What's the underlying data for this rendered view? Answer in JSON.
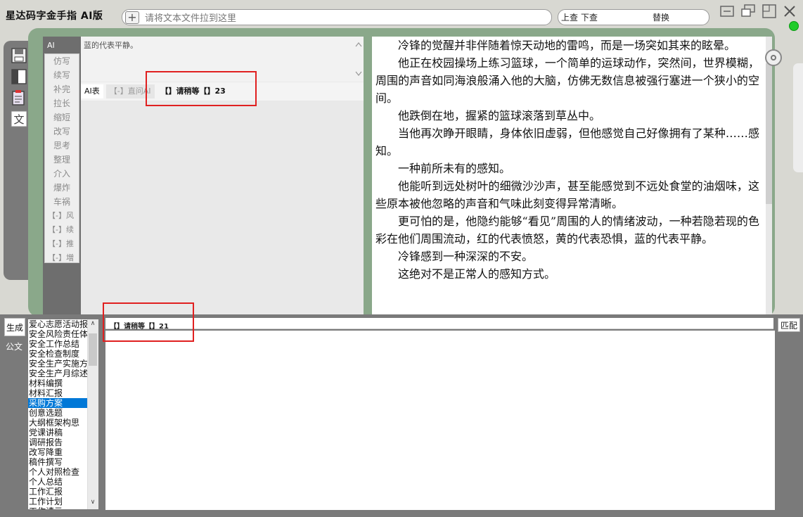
{
  "app": {
    "title": "星达码字金手指 AI版"
  },
  "toolbar": {
    "add_label": "+",
    "file_drop_placeholder": "请将文本文件拉到这里",
    "search_up": "上查",
    "search_down": "下查",
    "replace": "替换"
  },
  "ai": {
    "header": "AI",
    "commands": [
      "仿写",
      "续写",
      "补完",
      "拉长",
      "缩短",
      "改写",
      "思考",
      "整理",
      "介入",
      "爆炸",
      "车祸",
      "【-】风",
      "【-】续",
      "【-】推",
      "【-】増"
    ],
    "output_text": "蓝的代表平静。",
    "tabs": {
      "ai_table": "AI表",
      "ask_ai": "【-】直问AI",
      "wait": "【】请稍等【】23"
    }
  },
  "document": {
    "paragraphs": [
      "冷锋的觉醒并非伴随着惊天动地的雷鸣，而是一场突如其来的眩晕。",
      "他正在校园操场上练习篮球，一个简单的运球动作，突然间，世界模糊，周围的声音如同海浪般涌入他的大脑，仿佛无数信息被强行塞进一个狭小的空间。",
      "他跌倒在地，握紧的篮球滚落到草丛中。",
      "当他再次睁开眼睛，身体依旧虚弱，但他感觉自己好像拥有了某种……感知。",
      "一种前所未有的感知。",
      "他能听到远处树叶的细微沙沙声，甚至能感觉到不远处食堂的油烟味，这些原本被他忽略的声音和气味此刻变得异常清晰。",
      "更可怕的是，他隐约能够“看见”周围的人的情绪波动，一种若隐若现的色彩在他们周围流动，红的代表愤怒，黄的代表恐惧，蓝的代表平静。",
      "冷锋感到一种深深的不安。",
      "这绝对不是正常人的感知方式。"
    ]
  },
  "bottom": {
    "generate": "生成",
    "official": "公文",
    "match": "匹配",
    "tab_label": "【】请稍等【】21",
    "templates": [
      "爱心志愿活动报",
      "安全风险责任体",
      "安全工作总结",
      "安全检查制度",
      "安全生产实施方",
      "安全生产月综述",
      "材料编撰",
      "材料汇报",
      "采购方案",
      "创意选题",
      "大纲框架构思",
      "党课讲稿",
      "调研报告",
      "改写降重",
      "稿件撰写",
      "个人对照检查",
      "个人总结",
      "工作汇报",
      "工作计划",
      "工作请示"
    ],
    "selected_index": 8
  }
}
